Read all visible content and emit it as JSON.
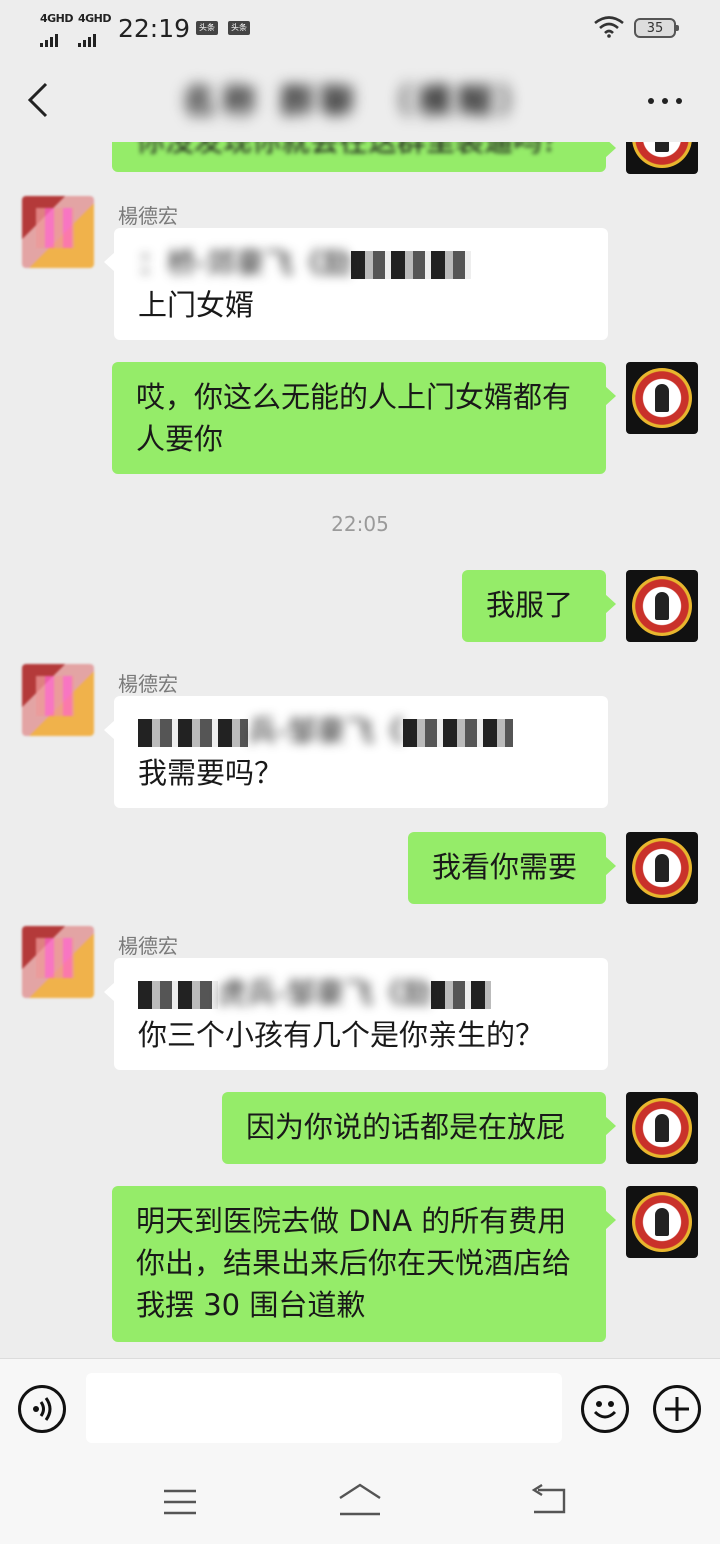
{
  "status_bar": {
    "network_1": "4GHD",
    "network_2": "4GHD",
    "time": "22:19",
    "news_badge_1": "头条",
    "news_badge_2": "头条",
    "battery": "35"
  },
  "header": {
    "title": "名称 群聊 （模糊）"
  },
  "messages": [
    {
      "side": "me",
      "text": "你没发现你就会在这群里装逼吗？"
    },
    {
      "side": "other",
      "sender": "楊德宏",
      "quote": "：桥-郊豪飞《励",
      "text": "上门女婿"
    },
    {
      "side": "me",
      "text": "哎，你这么无能的人上门女婿都有人要你"
    },
    {
      "side": "me",
      "text": "我服了"
    },
    {
      "side": "other",
      "sender": "楊德宏",
      "quote": "兵-邹豪飞《",
      "text": "我需要吗？"
    },
    {
      "side": "me",
      "text": "我看你需要"
    },
    {
      "side": "other",
      "sender": "楊德宏",
      "quote": "虎兵-邹豪飞《励",
      "text": "你三个小孩有几个是你亲生的？"
    },
    {
      "side": "me",
      "text": "因为你说的话都是在放屁"
    },
    {
      "side": "me",
      "text": "明天到医院去做 DNA 的所有费用你出，结果出来后你在天悦酒店给我摆 30 围台道歉"
    }
  ],
  "timestamp": "22:05",
  "input": {
    "value": "",
    "placeholder": ""
  },
  "colors": {
    "background": "#ededed",
    "bubble_me": "#95ec69",
    "bubble_other": "#ffffff"
  },
  "icons": {
    "back": "chevron-left-icon",
    "more": "more-dots-icon",
    "voice": "voice-icon",
    "emoji": "emoji-icon",
    "plus": "plus-icon"
  }
}
